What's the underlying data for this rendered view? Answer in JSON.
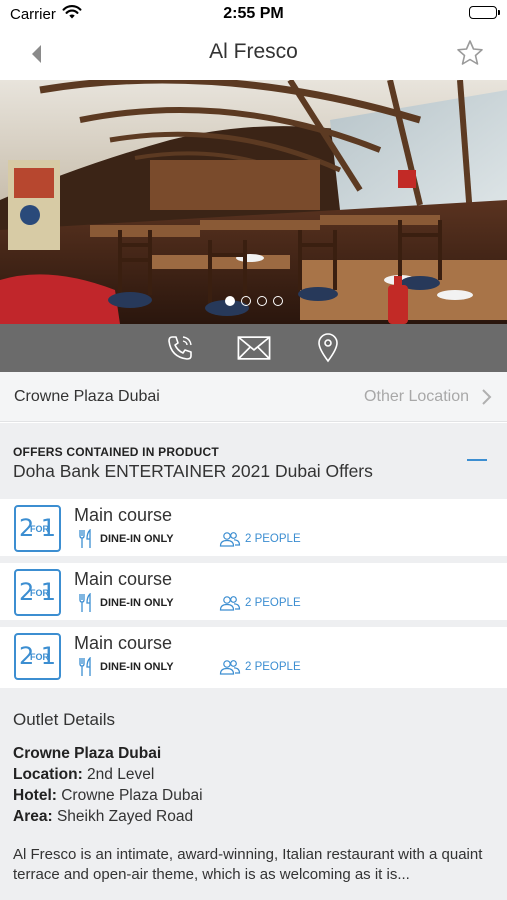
{
  "status_bar": {
    "carrier": "Carrier",
    "time": "2:55 PM"
  },
  "nav": {
    "title": "Al Fresco"
  },
  "gallery": {
    "image_count": 4,
    "active_index": 0
  },
  "location": {
    "name": "Crowne Plaza Dubai",
    "other_label": "Other Location"
  },
  "offers": {
    "caption": "OFFERS CONTAINED IN PRODUCT",
    "product": "Doha Bank ENTERTAINER 2021 Dubai Offers",
    "items": [
      {
        "title": "Main course",
        "dine": "DINE-IN ONLY",
        "people": "2 PEOPLE"
      },
      {
        "title": "Main course",
        "dine": "DINE-IN ONLY",
        "people": "2 PEOPLE"
      },
      {
        "title": "Main course",
        "dine": "DINE-IN ONLY",
        "people": "2 PEOPLE"
      }
    ],
    "badge": {
      "two": "2",
      "for": "FOR",
      "one": "1"
    }
  },
  "outlet": {
    "heading": "Outlet Details",
    "name": "Crowne Plaza Dubai",
    "location_label": "Location:",
    "location_value": " 2nd Level",
    "hotel_label": "Hotel:",
    "hotel_value": " Crowne Plaza Dubai",
    "area_label": "Area:",
    "area_value": " Sheikh Zayed Road",
    "description": "Al Fresco is an intimate, award-winning, Italian restaurant with a quaint terrace and open-air theme, which is as welcoming as it is..."
  },
  "colors": {
    "accent": "#3c8ed1",
    "action_bar": "#6b6b6b",
    "section_bg": "#eeeff1"
  },
  "icons": [
    "wifi-icon",
    "battery-icon",
    "back-chevron-icon",
    "star-icon",
    "phone-icon",
    "mail-icon",
    "location-pin-icon",
    "chevron-right-icon",
    "fork-knife-icon",
    "people-icon"
  ]
}
